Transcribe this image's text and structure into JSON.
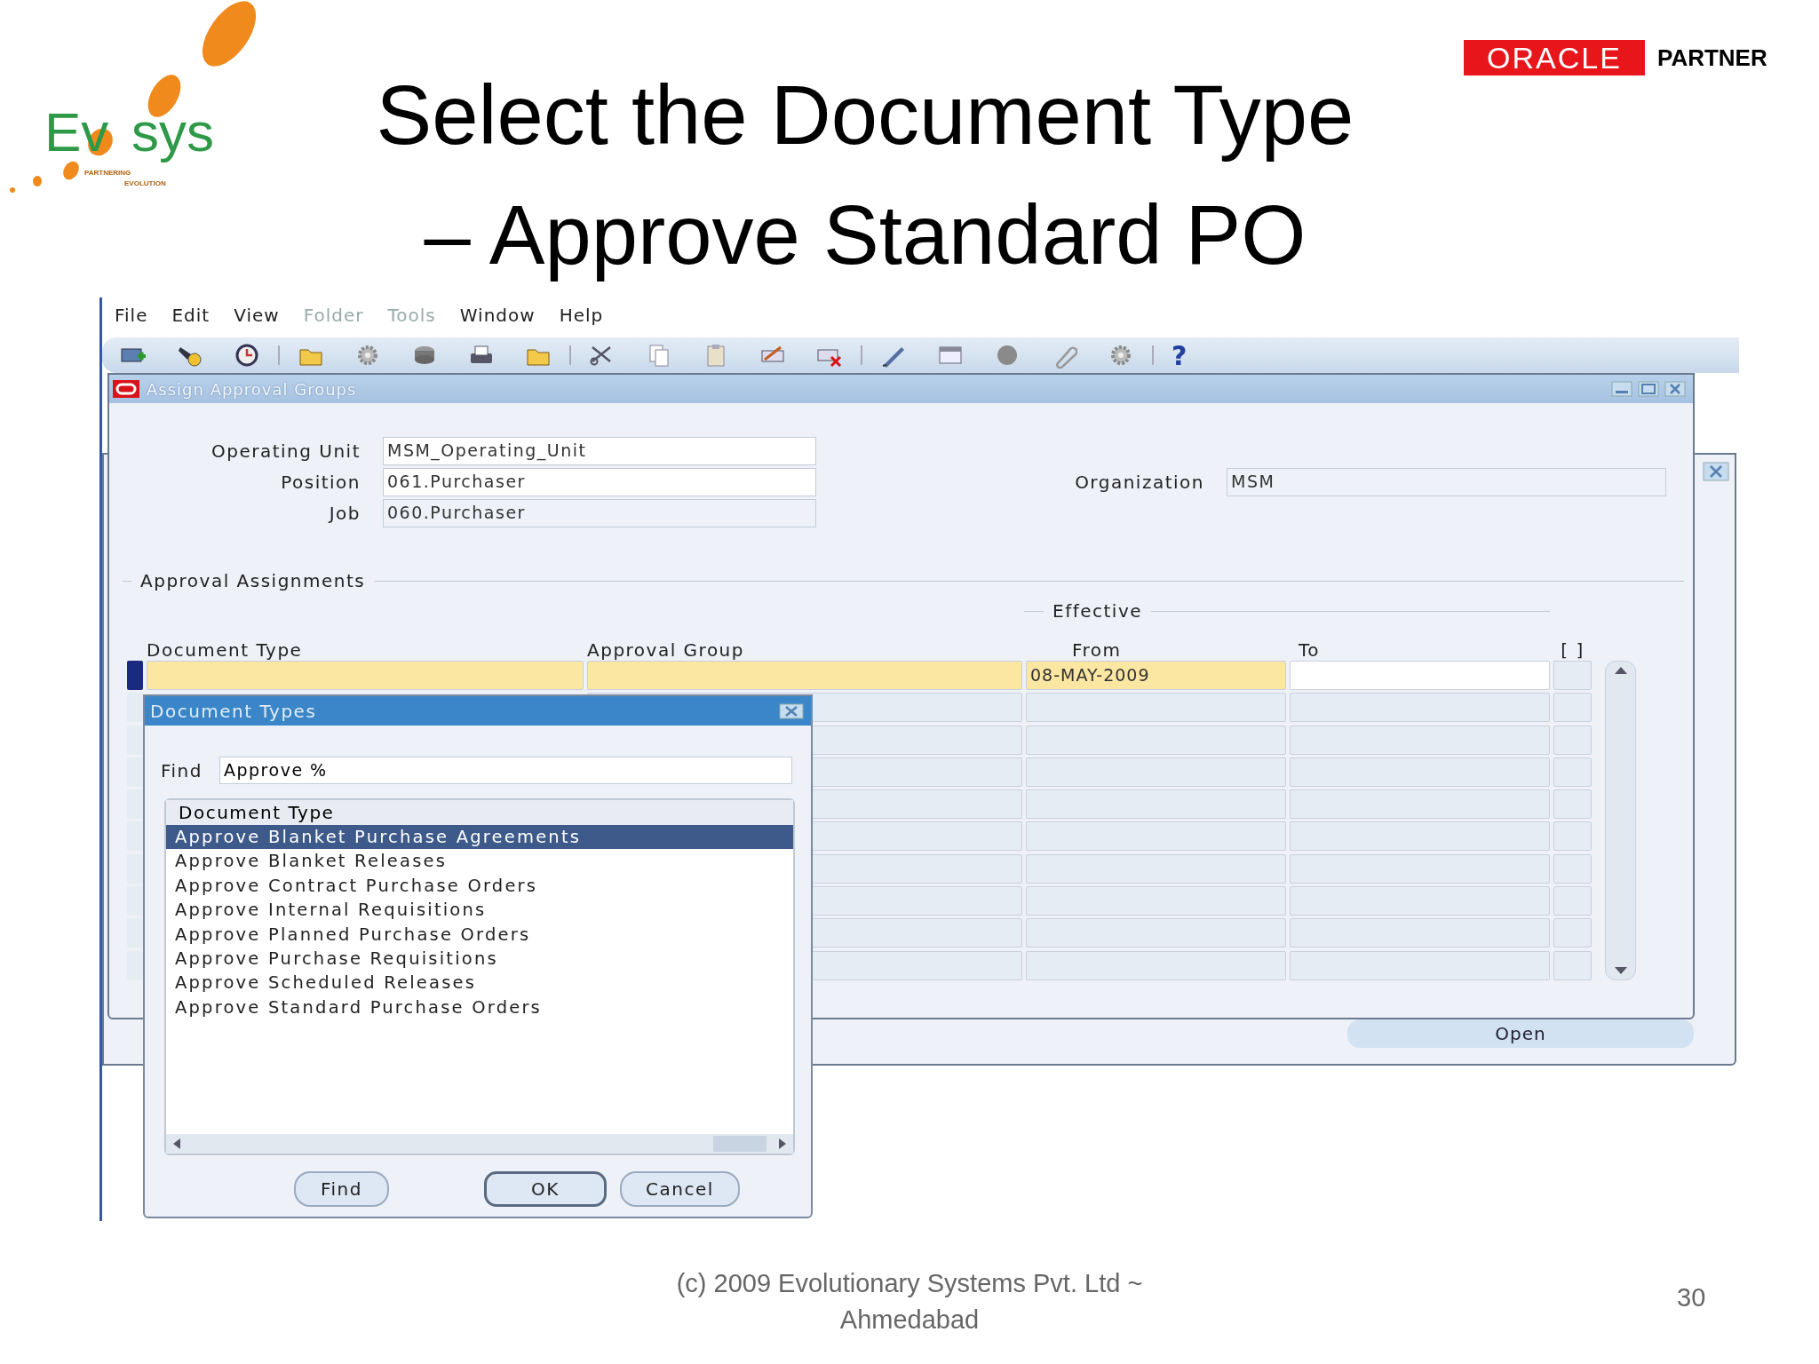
{
  "logo": {
    "word_start": "Ev",
    "word_end": "sys",
    "tagline": [
      "PARTNERING",
      "EVOLUTION"
    ]
  },
  "title": [
    "Select the Document Type",
    "– Approve Standard PO"
  ],
  "partner_logo": {
    "brand": "ORACLE",
    "label": "PARTNER"
  },
  "menu": [
    {
      "label": "File",
      "disabled": false
    },
    {
      "label": "Edit",
      "disabled": false
    },
    {
      "label": "View",
      "disabled": false
    },
    {
      "label": "Folder",
      "disabled": true
    },
    {
      "label": "Tools",
      "disabled": true
    },
    {
      "label": "Window",
      "disabled": false
    },
    {
      "label": "Help",
      "disabled": false
    }
  ],
  "toolbar": {
    "help": "?"
  },
  "window": {
    "title": "Assign Approval Groups",
    "fields": [
      {
        "label": "Operating Unit",
        "value": "MSM_Operating_Unit",
        "editable": true
      },
      {
        "label": "Position",
        "value": "061.Purchaser",
        "editable": true
      },
      {
        "label": "Job",
        "value": "060.Purchaser",
        "editable": false
      }
    ],
    "organization": {
      "label": "Organization",
      "value": "MSM",
      "editable": false
    },
    "section": "Approval Assignments",
    "group_header": "Effective",
    "columns": [
      "Document Type",
      "Approval Group",
      "From",
      "To",
      "[ ]"
    ],
    "rows": [
      {
        "from": "08-MAY-2009",
        "current": true
      },
      {
        "current": false
      },
      {
        "current": false
      },
      {
        "current": false
      },
      {
        "current": false
      },
      {
        "current": false
      },
      {
        "current": false
      },
      {
        "current": false
      },
      {
        "current": false
      },
      {
        "current": false
      }
    ]
  },
  "back_window": {
    "button": "Open"
  },
  "dialog": {
    "title": "Document Types",
    "find_label": "Find",
    "find_value": "Approve %",
    "list_header": "Document Type",
    "items": [
      {
        "label": "Approve Blanket Purchase Agreements",
        "selected": true
      },
      {
        "label": "Approve Blanket Releases",
        "selected": false
      },
      {
        "label": "Approve Contract Purchase Orders",
        "selected": false
      },
      {
        "label": "Approve Internal Requisitions",
        "selected": false
      },
      {
        "label": "Approve Planned Purchase Orders",
        "selected": false
      },
      {
        "label": "Approve Purchase Requisitions",
        "selected": false
      },
      {
        "label": "Approve Scheduled Releases",
        "selected": false
      },
      {
        "label": "Approve Standard Purchase Orders",
        "selected": false
      }
    ],
    "buttons": [
      {
        "label": "Find",
        "default": false
      },
      {
        "label": "OK",
        "default": true
      },
      {
        "label": "Cancel",
        "default": false
      }
    ]
  },
  "footer": {
    "lines": [
      "(c) 2009 Evolutionary Systems Pvt. Ltd ~",
      "Ahmedabad"
    ],
    "page": "30"
  }
}
